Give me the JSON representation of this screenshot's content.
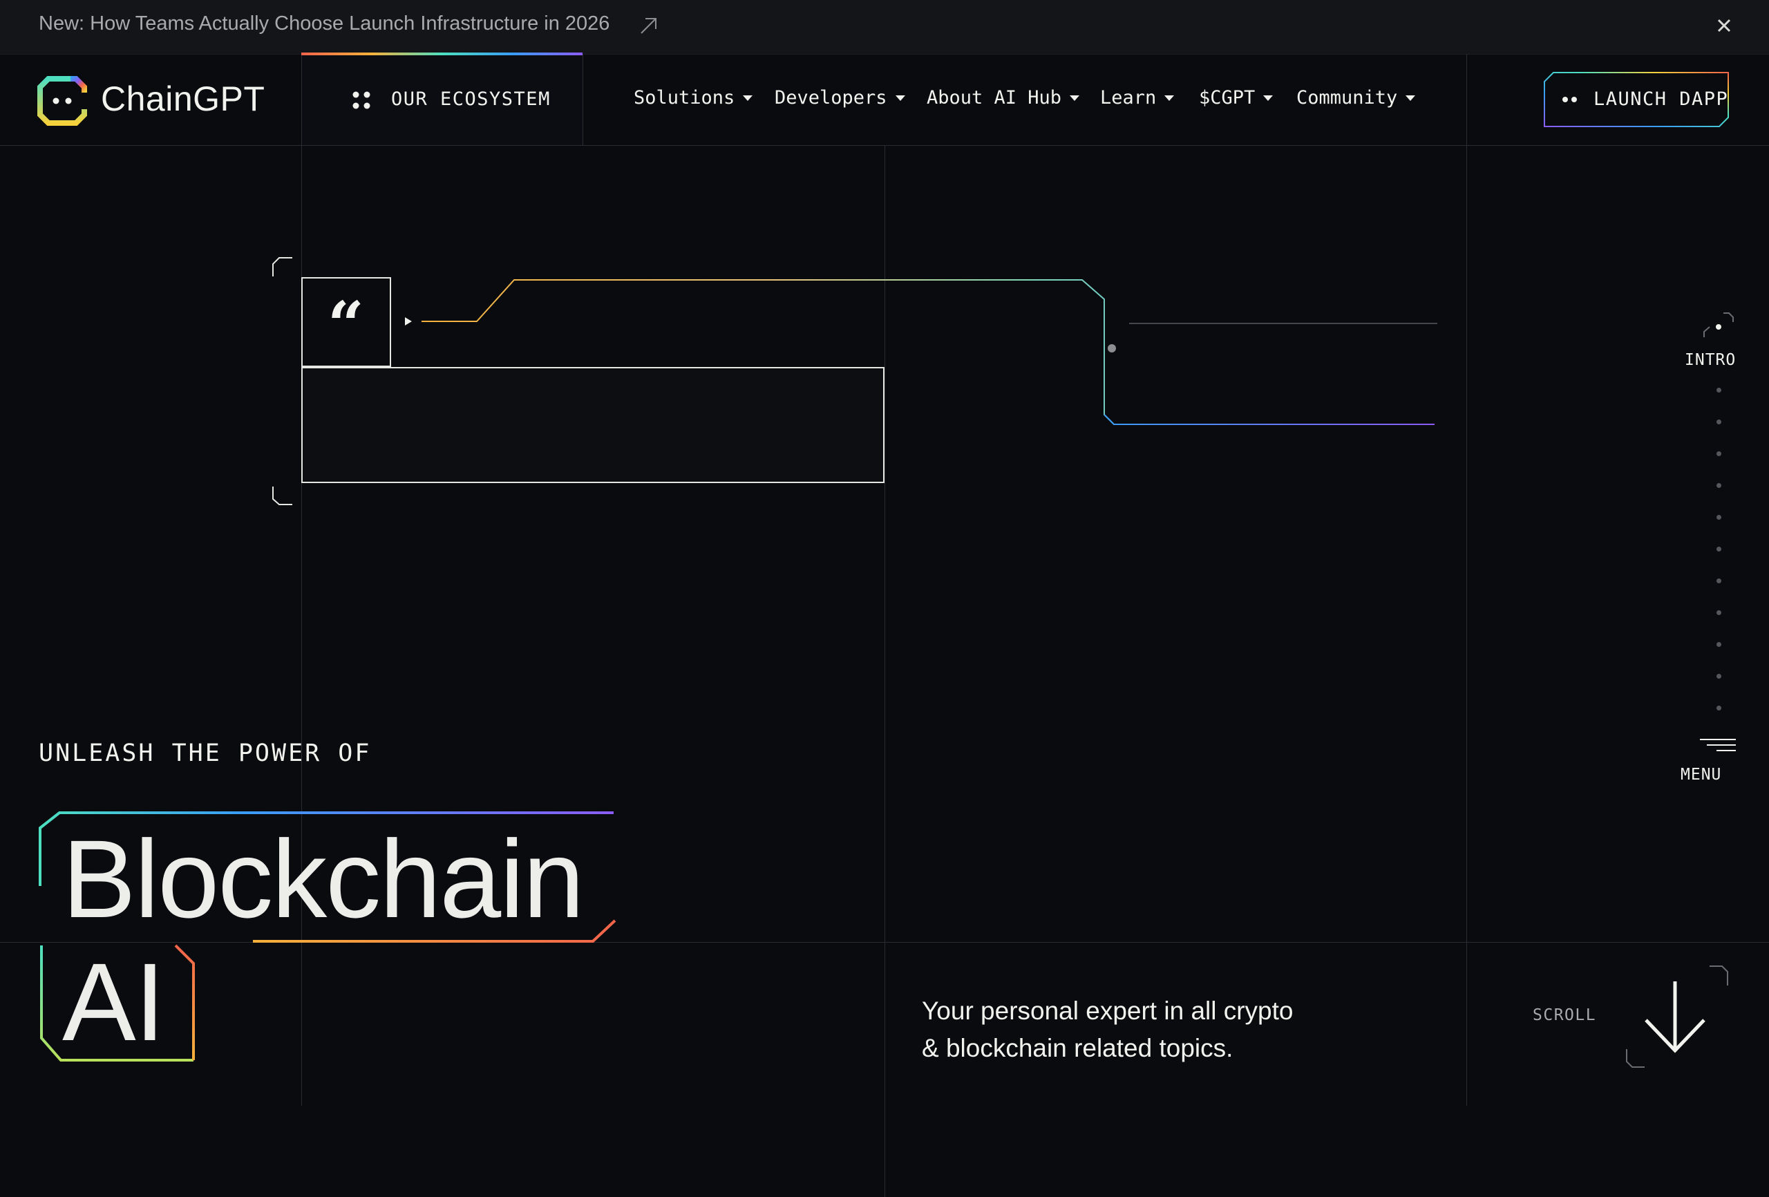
{
  "announcement": {
    "prefix": "New:",
    "text": "How Teams Actually Choose Launch Infrastructure in 2026",
    "link_icon": "arrow-up-right-icon",
    "close_icon": "close-icon"
  },
  "header": {
    "brand": "ChainGPT",
    "ecosystem_label": "OUR ECOSYSTEM",
    "nav": [
      {
        "label": "Solutions"
      },
      {
        "label": "Developers"
      },
      {
        "label": "About AI Hub"
      },
      {
        "label": "Learn"
      },
      {
        "label": "$CGPT"
      },
      {
        "label": "Community"
      }
    ],
    "launch_label": "LAUNCH DAPP"
  },
  "side_nav": {
    "intro_label": "INTRO",
    "menu_label": "MENU",
    "dot_count": 11
  },
  "hero": {
    "kicker": "UNLEASH THE POWER OF",
    "line1": "Blockchain",
    "line2": "AI",
    "tagline_line1": "Your personal expert in all crypto",
    "tagline_line2": "& blockchain related topics.",
    "scroll_label": "SCROLL"
  },
  "colors": {
    "background": "#0a0b0f",
    "text": "#f2f2ee",
    "muted": "#a9aaae",
    "grid": "#2a2c32",
    "gradient": [
      "#f2644a",
      "#f5b13c",
      "#4ddfc0",
      "#3a9df5",
      "#8a5cf5"
    ]
  }
}
